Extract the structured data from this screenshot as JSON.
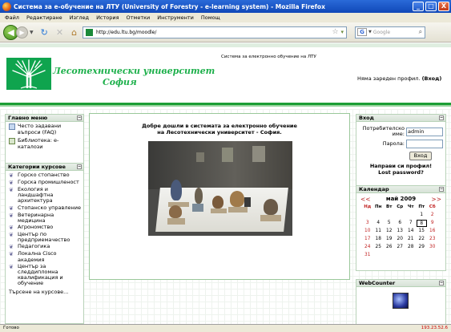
{
  "window": {
    "title": "Система за е-обучение на ЛТУ (University of Forestry - e-learning system) - Mozilla Firefox",
    "minimize": "_",
    "maximize": "□",
    "close": "X"
  },
  "menu": [
    "Файл",
    "Редактиране",
    "Изглед",
    "История",
    "Отметки",
    "Инструменти",
    "Помощ"
  ],
  "nav": {
    "url": "http://edu.ltu.bg/moodle/",
    "search_placeholder": "Google"
  },
  "header": {
    "site_name": "Система за електронно обучение на ЛТУ",
    "university_name": "Лесотехнически университет",
    "city": "София",
    "login_text": "Няма зареден профил.",
    "login_link": "(Вход)"
  },
  "main_menu": {
    "title": "Главно меню",
    "items": [
      {
        "label": "Често задавани въпроси (FAQ)",
        "icon": "faq-icon"
      },
      {
        "label": "Библиотека: е-каталози",
        "icon": "library-icon"
      }
    ]
  },
  "categories": {
    "title": "Категории курсове",
    "items": [
      "Горско стопанство",
      "Горска промишленост",
      "Екология и ландшафтна архитектура",
      "Стопанско управление",
      "Ветеринарна медицина",
      "Агрономство",
      "Център по предприемачество",
      "Педагогика",
      "Локална Cisco академия",
      "Център за следдипломна квалификация и обучение"
    ],
    "search_link": "Търсене на курсове..."
  },
  "center": {
    "welcome_line1": "Добре дошли в системата за електронно обучение",
    "welcome_line2": "на Лесотехнически университет - София."
  },
  "login_block": {
    "title": "Вход",
    "username_label": "Потребителско име:",
    "username_value": "admin",
    "password_label": "Парола:",
    "button": "Вход",
    "new_profile": "Направи си профил!",
    "lost_password": "Lost password?"
  },
  "calendar": {
    "title": "Календар",
    "prev": "<<",
    "next": ">>",
    "month": "май 2009",
    "days": [
      "Нд",
      "Пн",
      "Вт",
      "Ср",
      "Чт",
      "Пт",
      "Сб"
    ],
    "weeks": [
      [
        "",
        "",
        "",
        "",
        "",
        "1",
        "2"
      ],
      [
        "3",
        "4",
        "5",
        "6",
        "7",
        "8",
        "9"
      ],
      [
        "10",
        "11",
        "12",
        "13",
        "14",
        "15",
        "16"
      ],
      [
        "17",
        "18",
        "19",
        "20",
        "21",
        "22",
        "23"
      ],
      [
        "24",
        "25",
        "26",
        "27",
        "28",
        "29",
        "30"
      ],
      [
        "31",
        "",
        "",
        "",
        "",
        "",
        ""
      ]
    ],
    "today": "8"
  },
  "webcounter": {
    "title": "WebCounter"
  },
  "status": {
    "text": "Готово",
    "ip": "193.23.52.6"
  }
}
